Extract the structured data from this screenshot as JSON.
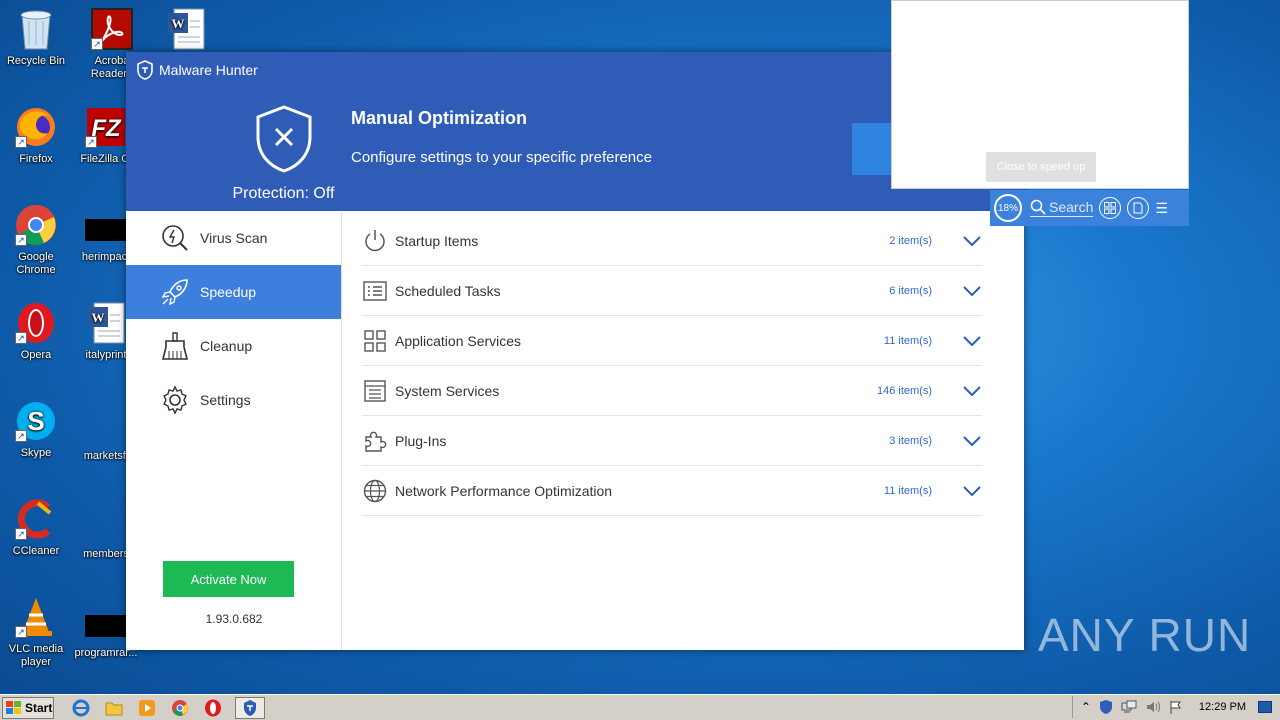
{
  "desktop": {
    "icons": [
      {
        "label": "Recycle Bin"
      },
      {
        "label": "Acroba Reader I"
      },
      {
        "label": ""
      },
      {
        "label": "Firefox"
      },
      {
        "label": "FileZilla Cl"
      },
      {
        "label": "Google Chrome"
      },
      {
        "label": "herimpact"
      },
      {
        "label": "Opera"
      },
      {
        "label": "italyprint"
      },
      {
        "label": "Skype"
      },
      {
        "label": "marketsfi"
      },
      {
        "label": "CCleaner"
      },
      {
        "label": "members"
      },
      {
        "label": "VLC media player"
      },
      {
        "label": "programrar..."
      }
    ]
  },
  "app": {
    "title": "Malware Hunter",
    "protection_status": "Protection: Off",
    "header_title": "Manual Optimization",
    "header_subtitle": "Configure settings to your specific preference",
    "nav": [
      {
        "label": "Virus Scan",
        "icon": "virus-scan-icon"
      },
      {
        "label": "Speedup",
        "icon": "rocket-icon"
      },
      {
        "label": "Cleanup",
        "icon": "broom-icon"
      },
      {
        "label": "Settings",
        "icon": "gear-icon"
      }
    ],
    "active_nav": "Speedup",
    "activate_label": "Activate Now",
    "version": "1.93.0.682",
    "rows": [
      {
        "name": "Startup Items",
        "count": "2 item(s)",
        "icon": "power-icon"
      },
      {
        "name": "Scheduled Tasks",
        "count": "6 item(s)",
        "icon": "list-icon"
      },
      {
        "name": "Application Services",
        "count": "11 item(s)",
        "icon": "grid-icon"
      },
      {
        "name": "System Services",
        "count": "146 item(s)",
        "icon": "document-list-icon"
      },
      {
        "name": "Plug-Ins",
        "count": "3 item(s)",
        "icon": "puzzle-icon"
      },
      {
        "name": "Network Performance Optimization",
        "count": "11 item(s)",
        "icon": "globe-icon"
      }
    ],
    "colors": {
      "header": "#2f5cb6",
      "active": "#3d7fdc",
      "activate": "#1db954",
      "count": "#2f6bc8"
    }
  },
  "overlay": {
    "close_label": "Close to speed up",
    "percent": "18%",
    "search_label": "Search"
  },
  "watermark": {
    "text": "ANY RUN"
  },
  "taskbar": {
    "start_label": "Start",
    "clock": "12:29 PM"
  }
}
